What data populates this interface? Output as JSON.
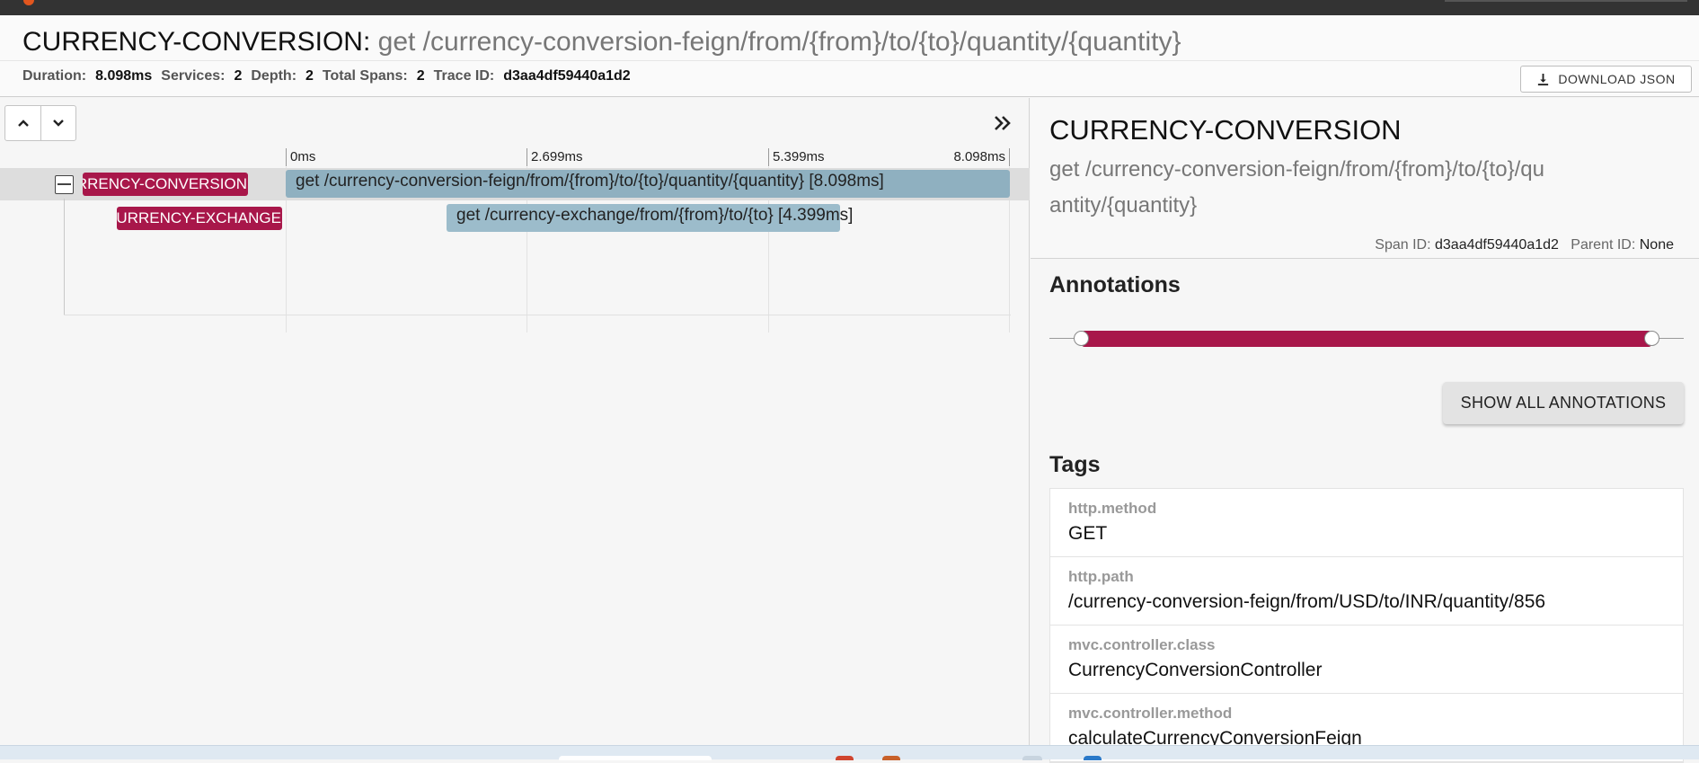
{
  "header": {
    "service": "CURRENCY-CONVERSION",
    "separator": ":",
    "route": "get /currency-conversion-feign/from/{from}/to/{to}/quantity/{quantity}",
    "stats": [
      {
        "label": "Duration:",
        "value": "8.098ms"
      },
      {
        "label": "Services:",
        "value": "2"
      },
      {
        "label": "Depth:",
        "value": "2"
      },
      {
        "label": "Total Spans:",
        "value": "2"
      },
      {
        "label": "Trace ID:",
        "value": "d3aa4df59440a1d2"
      }
    ],
    "download_label": "DOWNLOAD JSON"
  },
  "timeline": {
    "ticks": [
      "0ms",
      "2.699ms",
      "5.399ms",
      "8.098ms"
    ],
    "spans": [
      {
        "service": "CURRENCY-CONVERSION",
        "name": "get /currency-conversion-feign/from/{from}/to/{to}/quantity/{quantity} [8.098ms]"
      },
      {
        "service": "CURRENCY-EXCHANGE",
        "name": "get /currency-exchange/from/{from}/to/{to} [4.399ms]"
      }
    ]
  },
  "detail": {
    "service": "CURRENCY-CONVERSION",
    "route": "get /currency-conversion-feign/from/{from}/to/{to}/quantity/{quantity}",
    "span_id_label": "Span ID:",
    "span_id": "d3aa4df59440a1d2",
    "parent_id_label": "Parent ID:",
    "parent_id": "None",
    "annotations_title": "Annotations",
    "show_all_label": "SHOW ALL ANNOTATIONS",
    "tags_title": "Tags",
    "tags": [
      {
        "key": "http.method",
        "value": "GET"
      },
      {
        "key": "http.path",
        "value": "/currency-conversion-feign/from/USD/to/INR/quantity/856"
      },
      {
        "key": "mvc.controller.class",
        "value": "CurrencyConversionController"
      },
      {
        "key": "mvc.controller.method",
        "value": "calculateCurrencyConversionFeign"
      }
    ]
  },
  "colors": {
    "service_pill": "#a8174a",
    "span_bar": "#8fb0c0"
  }
}
